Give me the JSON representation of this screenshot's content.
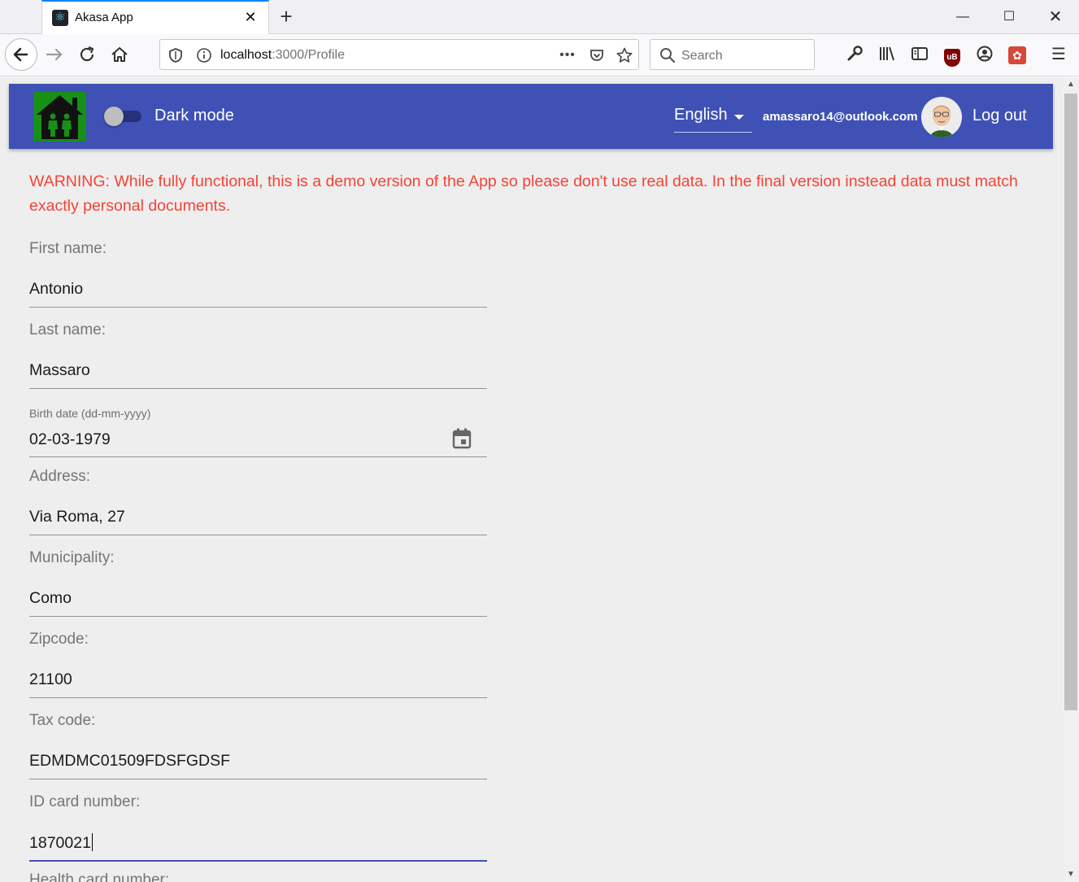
{
  "browser": {
    "tab": {
      "title": "Akasa App",
      "close": "✕"
    },
    "new_tab": "+",
    "window": {
      "minimize": "—",
      "maximize": "☐",
      "close": "✕"
    },
    "url": {
      "host": "localhost",
      "path": ":3000/Profile"
    },
    "search": {
      "placeholder": "Search"
    },
    "menu_glyph": "☰",
    "ublock_label": "uB"
  },
  "app": {
    "dark_mode": {
      "label": "Dark mode",
      "enabled": false
    },
    "language": {
      "selected": "English"
    },
    "user": {
      "email": "amassaro14@outlook.com"
    },
    "logout_label": "Log out"
  },
  "warning": "WARNING: While fully functional, this is a demo version of the App so please don't use real data. In the final version instead data must match exactly personal documents.",
  "form": {
    "first_name": {
      "label": "First name:",
      "value": "Antonio"
    },
    "last_name": {
      "label": "Last name:",
      "value": "Massaro"
    },
    "birth_date": {
      "label": "Birth date (dd-mm-yyyy)",
      "value": "02-03-1979"
    },
    "address": {
      "label": "Address:",
      "value": "Via Roma, 27"
    },
    "municipality": {
      "label": "Municipality:",
      "value": "Como"
    },
    "zipcode": {
      "label": "Zipcode:",
      "value": "21100"
    },
    "tax_code": {
      "label": "Tax code:",
      "value": "EDMDMC01509FDSFGDSF"
    },
    "id_card": {
      "label": "ID card number:",
      "value": "1870021"
    },
    "next_label_partial": "Health card number:"
  },
  "colors": {
    "appbar": "#3f51b5",
    "warning": "#f44336",
    "logo_bg": "#179017",
    "page_bg": "#eeeeee"
  },
  "icons": [
    "react-favicon-icon",
    "back-arrow-icon",
    "forward-arrow-icon",
    "reload-icon",
    "home-icon",
    "shield-icon",
    "info-icon",
    "more-icon",
    "pocket-icon",
    "star-icon",
    "search-icon",
    "wrench-icon",
    "library-icon",
    "sidebar-icon",
    "ublock-icon",
    "account-icon",
    "extension-icon",
    "menu-icon",
    "calendar-icon"
  ]
}
